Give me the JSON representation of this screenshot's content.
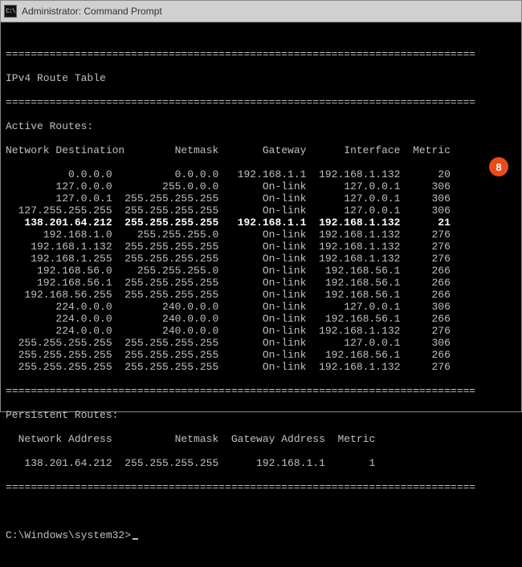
{
  "titlebar": {
    "icon_text": "C:\\",
    "title": "Administrator: Command Prompt"
  },
  "section_title": "IPv4 Route Table",
  "active_routes_label": "Active Routes:",
  "headers": {
    "net_dest": "Network Destination",
    "netmask": "Netmask",
    "gateway": "Gateway",
    "interface": "Interface",
    "metric": "Metric"
  },
  "active_routes": [
    {
      "dest": "0.0.0.0",
      "mask": "0.0.0.0",
      "gw": "192.168.1.1",
      "iface": "192.168.1.132",
      "metric": "20",
      "hl": false
    },
    {
      "dest": "127.0.0.0",
      "mask": "255.0.0.0",
      "gw": "On-link",
      "iface": "127.0.0.1",
      "metric": "306",
      "hl": false
    },
    {
      "dest": "127.0.0.1",
      "mask": "255.255.255.255",
      "gw": "On-link",
      "iface": "127.0.0.1",
      "metric": "306",
      "hl": false
    },
    {
      "dest": "127.255.255.255",
      "mask": "255.255.255.255",
      "gw": "On-link",
      "iface": "127.0.0.1",
      "metric": "306",
      "hl": false
    },
    {
      "dest": "138.201.64.212",
      "mask": "255.255.255.255",
      "gw": "192.168.1.1",
      "iface": "192.168.1.132",
      "metric": "21",
      "hl": true
    },
    {
      "dest": "192.168.1.0",
      "mask": "255.255.255.0",
      "gw": "On-link",
      "iface": "192.168.1.132",
      "metric": "276",
      "hl": false
    },
    {
      "dest": "192.168.1.132",
      "mask": "255.255.255.255",
      "gw": "On-link",
      "iface": "192.168.1.132",
      "metric": "276",
      "hl": false
    },
    {
      "dest": "192.168.1.255",
      "mask": "255.255.255.255",
      "gw": "On-link",
      "iface": "192.168.1.132",
      "metric": "276",
      "hl": false
    },
    {
      "dest": "192.168.56.0",
      "mask": "255.255.255.0",
      "gw": "On-link",
      "iface": "192.168.56.1",
      "metric": "266",
      "hl": false
    },
    {
      "dest": "192.168.56.1",
      "mask": "255.255.255.255",
      "gw": "On-link",
      "iface": "192.168.56.1",
      "metric": "266",
      "hl": false
    },
    {
      "dest": "192.168.56.255",
      "mask": "255.255.255.255",
      "gw": "On-link",
      "iface": "192.168.56.1",
      "metric": "266",
      "hl": false
    },
    {
      "dest": "224.0.0.0",
      "mask": "240.0.0.0",
      "gw": "On-link",
      "iface": "127.0.0.1",
      "metric": "306",
      "hl": false
    },
    {
      "dest": "224.0.0.0",
      "mask": "240.0.0.0",
      "gw": "On-link",
      "iface": "192.168.56.1",
      "metric": "266",
      "hl": false
    },
    {
      "dest": "224.0.0.0",
      "mask": "240.0.0.0",
      "gw": "On-link",
      "iface": "192.168.1.132",
      "metric": "276",
      "hl": false
    },
    {
      "dest": "255.255.255.255",
      "mask": "255.255.255.255",
      "gw": "On-link",
      "iface": "127.0.0.1",
      "metric": "306",
      "hl": false
    },
    {
      "dest": "255.255.255.255",
      "mask": "255.255.255.255",
      "gw": "On-link",
      "iface": "192.168.56.1",
      "metric": "266",
      "hl": false
    },
    {
      "dest": "255.255.255.255",
      "mask": "255.255.255.255",
      "gw": "On-link",
      "iface": "192.168.1.132",
      "metric": "276",
      "hl": false
    }
  ],
  "persistent_routes_label": "Persistent Routes:",
  "persistent_headers": {
    "net_addr": "Network Address",
    "netmask": "Netmask",
    "gw_addr": "Gateway Address",
    "metric": "Metric"
  },
  "persistent_routes": [
    {
      "dest": "138.201.64.212",
      "mask": "255.255.255.255",
      "gw": "192.168.1.1",
      "metric": "1"
    }
  ],
  "divider": "===========================================================================",
  "prompt": "C:\\Windows\\system32>",
  "badge": "8",
  "col_widths": {
    "c1": 17,
    "c2": 17,
    "c3": 14,
    "c4": 15,
    "c5": 8
  },
  "pcol_widths": {
    "c1": 17,
    "c2": 17,
    "c3": 17,
    "c4": 8
  }
}
